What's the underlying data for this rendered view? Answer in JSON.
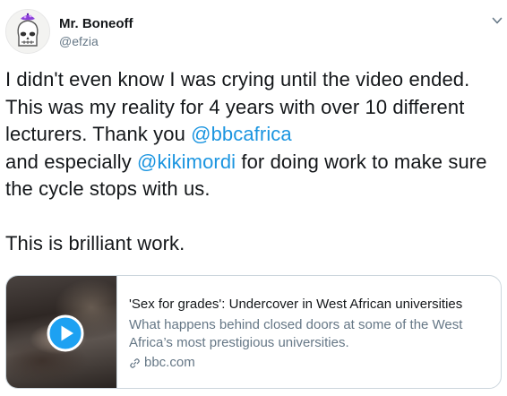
{
  "author": {
    "display_name": "Mr. Boneoff",
    "handle": "@efzia",
    "avatar_icon": "skull-avatar-icon"
  },
  "menu_icon": "chevron-down-icon",
  "tweet": {
    "line1": "I didn't even know I was crying until the video ended.",
    "line2": "This was my reality for 4 years with over 10 different",
    "line3_text": "lecturers. Thank you ",
    "mention1": "@bbcafrica",
    "line4_prefix": "and especially ",
    "mention2": "@kikimordi",
    "line4_suffix": " for doing work to make sure",
    "line5": "the cycle stops with us.",
    "line6": "This is brilliant work."
  },
  "card": {
    "title": "'Sex for grades': Undercover in West African universities",
    "description": "What happens behind closed doors at some of the West Africa’s most prestigious universities.",
    "domain": "bbc.com",
    "play_icon": "play-icon",
    "link_icon": "link-icon"
  },
  "colors": {
    "link": "#1b95e0",
    "secondary_text": "#657786",
    "primary_text": "#14171a",
    "card_border": "#ccd6dd"
  }
}
